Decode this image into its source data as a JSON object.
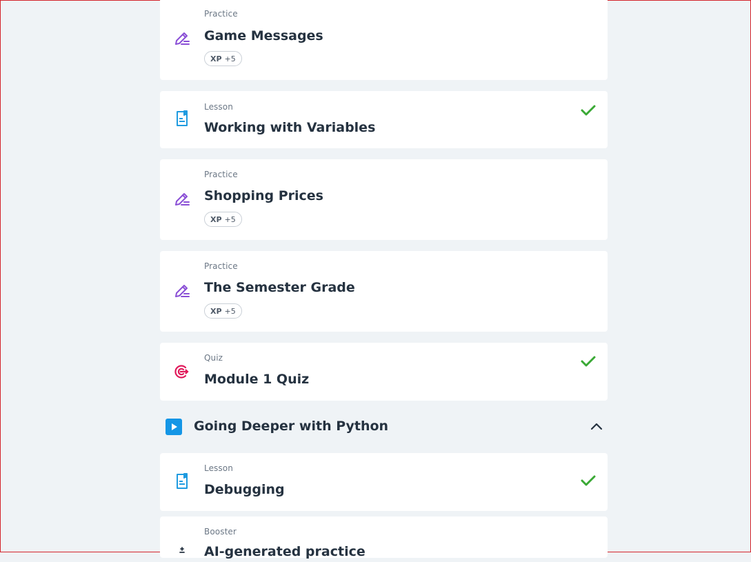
{
  "items": [
    {
      "kind": "Practice",
      "title": "Game Messages",
      "xp_label": "XP",
      "xp_value": "+5",
      "icon": "pencil-lines-icon",
      "completed": false
    },
    {
      "kind": "Lesson",
      "title": "Working with Variables",
      "icon": "document-bookmark-icon",
      "completed": true
    },
    {
      "kind": "Practice",
      "title": "Shopping Prices",
      "xp_label": "XP",
      "xp_value": "+5",
      "icon": "pencil-lines-icon",
      "completed": false
    },
    {
      "kind": "Practice",
      "title": "The Semester Grade",
      "xp_label": "XP",
      "xp_value": "+5",
      "icon": "pencil-lines-icon",
      "completed": false
    },
    {
      "kind": "Quiz",
      "title": "Module 1 Quiz",
      "icon": "target-icon",
      "completed": true
    }
  ],
  "section": {
    "title": "Going Deeper with Python",
    "icon": "play-icon",
    "expanded": true
  },
  "section_items": [
    {
      "kind": "Lesson",
      "title": "Debugging",
      "icon": "document-bookmark-icon",
      "completed": true
    },
    {
      "kind": "Booster",
      "title": "AI-generated practice",
      "icon": "booster-icon",
      "completed": false
    }
  ],
  "colors": {
    "practice": "#8a4fd6",
    "lesson": "#1f9be0",
    "quiz": "#e0195a",
    "check": "#3aa935",
    "section_play": "#1496e6",
    "background": "#eff3f6"
  }
}
